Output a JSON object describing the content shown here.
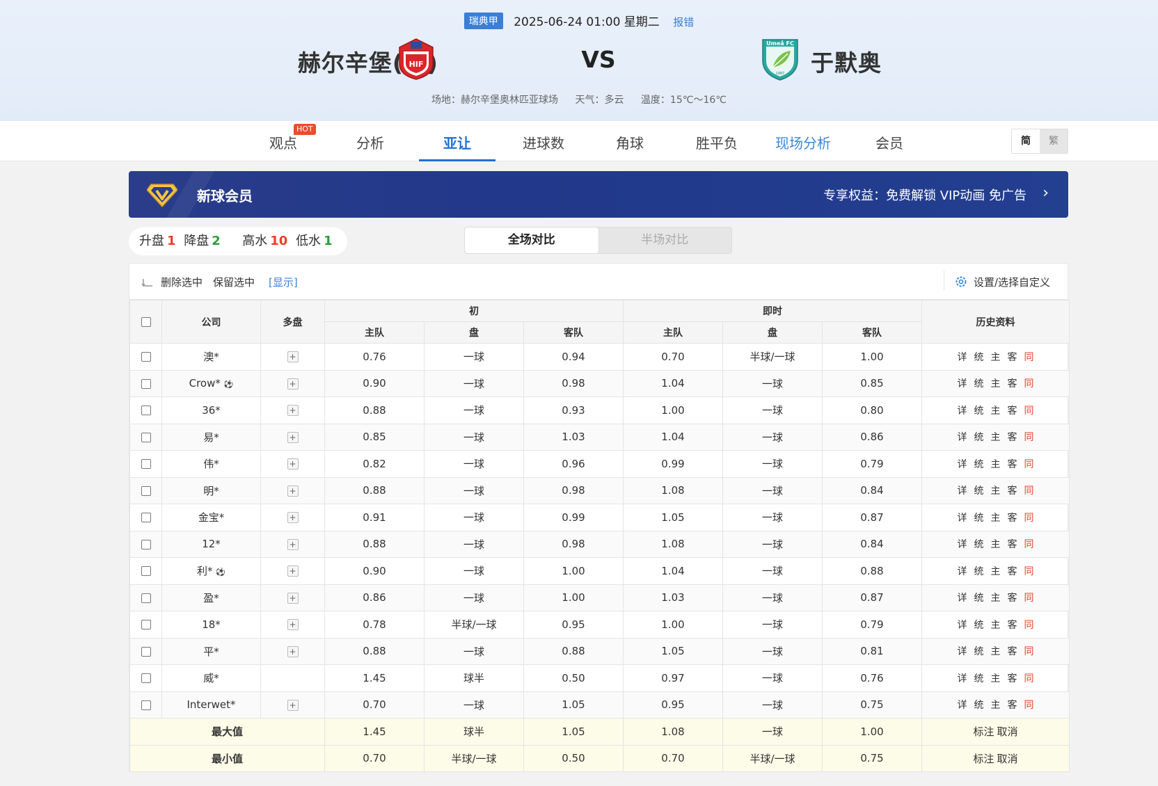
{
  "match": {
    "league": "瑞典甲",
    "datetime": "2025-06-24 01:00 星期二",
    "report": "报错",
    "home": "赫尔辛堡(主)",
    "vs": "VS",
    "away": "于默奥",
    "venue": "场地：赫尔辛堡奥林匹亚球场",
    "weather": "天气：多云",
    "temperature": "温度：15℃～16℃",
    "home_logo_text": "HIF",
    "away_logo_text": "Umeå FC",
    "away_logo_year": "1987"
  },
  "nav": {
    "items": [
      "观点",
      "分析",
      "亚让",
      "进球数",
      "角球",
      "胜平负",
      "现场分析",
      "会员"
    ],
    "active": "亚让",
    "hot": "HOT",
    "lang_simplified": "简",
    "lang_traditional": "繁"
  },
  "vip": {
    "title": "新球会员",
    "perks": "专享权益：免费解锁 VIP动画 免广告"
  },
  "summary": {
    "up_label": "升盘",
    "up": "1",
    "down_label": "降盘",
    "down": "2",
    "high_label": "高水",
    "high": "10",
    "low_label": "低水",
    "low": "1"
  },
  "compare": {
    "full": "全场对比",
    "half": "半场对比"
  },
  "toolbar": {
    "delete": "删除选中",
    "keep": "保留选中",
    "show": "[显示]",
    "settings": "设置/选择自定义"
  },
  "headers": {
    "company": "公司",
    "multi": "多盘",
    "initial": "初",
    "live": "即时",
    "home": "主队",
    "line": "盘",
    "away": "客队",
    "history": "历史资料"
  },
  "history_labels": [
    "详",
    "统",
    "主",
    "客",
    "同"
  ],
  "rows": [
    {
      "company": "澳*",
      "ball": false,
      "plus": true,
      "i_home": "0.76",
      "i_line": "一球",
      "i_away": "0.94",
      "l_home": "0.70",
      "l_line": "半球/一球",
      "l_away": "1.00"
    },
    {
      "company": "Crow*",
      "ball": true,
      "plus": true,
      "i_home": "0.90",
      "i_line": "一球",
      "i_away": "0.98",
      "l_home": "1.04",
      "l_line": "一球",
      "l_away": "0.85"
    },
    {
      "company": "36*",
      "ball": false,
      "plus": true,
      "i_home": "0.88",
      "i_line": "一球",
      "i_away": "0.93",
      "l_home": "1.00",
      "l_line": "一球",
      "l_away": "0.80"
    },
    {
      "company": "易*",
      "ball": false,
      "plus": true,
      "i_home": "0.85",
      "i_line": "一球",
      "i_away": "1.03",
      "l_home": "1.04",
      "l_line": "一球",
      "l_away": "0.86"
    },
    {
      "company": "伟*",
      "ball": false,
      "plus": true,
      "i_home": "0.82",
      "i_line": "一球",
      "i_away": "0.96",
      "l_home": "0.99",
      "l_line": "一球",
      "l_away": "0.79"
    },
    {
      "company": "明*",
      "ball": false,
      "plus": true,
      "i_home": "0.88",
      "i_line": "一球",
      "i_away": "0.98",
      "l_home": "1.08",
      "l_line": "一球",
      "l_away": "0.84"
    },
    {
      "company": "金宝*",
      "ball": false,
      "plus": true,
      "i_home": "0.91",
      "i_line": "一球",
      "i_away": "0.99",
      "l_home": "1.05",
      "l_line": "一球",
      "l_away": "0.87"
    },
    {
      "company": "12*",
      "ball": false,
      "plus": true,
      "i_home": "0.88",
      "i_line": "一球",
      "i_away": "0.98",
      "l_home": "1.08",
      "l_line": "一球",
      "l_away": "0.84"
    },
    {
      "company": "利*",
      "ball": true,
      "plus": true,
      "i_home": "0.90",
      "i_line": "一球",
      "i_away": "1.00",
      "l_home": "1.04",
      "l_line": "一球",
      "l_away": "0.88"
    },
    {
      "company": "盈*",
      "ball": false,
      "plus": true,
      "i_home": "0.86",
      "i_line": "一球",
      "i_away": "1.00",
      "l_home": "1.03",
      "l_line": "一球",
      "l_away": "0.87"
    },
    {
      "company": "18*",
      "ball": false,
      "plus": true,
      "i_home": "0.78",
      "i_line": "半球/一球",
      "i_away": "0.95",
      "l_home": "1.00",
      "l_line": "一球",
      "l_away": "0.79"
    },
    {
      "company": "平*",
      "ball": false,
      "plus": true,
      "i_home": "0.88",
      "i_line": "一球",
      "i_away": "0.88",
      "l_home": "1.05",
      "l_line": "一球",
      "l_away": "0.81"
    },
    {
      "company": "威*",
      "ball": false,
      "plus": false,
      "i_home": "1.45",
      "i_line": "球半",
      "i_away": "0.50",
      "l_home": "0.97",
      "l_line": "一球",
      "l_away": "0.76"
    },
    {
      "company": "Interwet*",
      "ball": false,
      "plus": true,
      "i_home": "0.70",
      "i_line": "一球",
      "i_away": "1.05",
      "l_home": "0.95",
      "l_line": "一球",
      "l_away": "0.75"
    }
  ],
  "stats": [
    {
      "label": "最大值",
      "i_home": "1.45",
      "i_line": "球半",
      "i_away": "1.05",
      "l_home": "1.08",
      "l_line": "一球",
      "l_away": "1.00",
      "mark": "标注",
      "cancel": "取消"
    },
    {
      "label": "最小值",
      "i_home": "0.70",
      "i_line": "半球/一球",
      "i_away": "0.50",
      "l_home": "0.70",
      "l_line": "半球/一球",
      "l_away": "0.75",
      "mark": "标注",
      "cancel": "取消"
    }
  ],
  "colors": {
    "accent": "#1f6fd6",
    "up": "#e8402a",
    "down": "#2f9b3c",
    "vip_bg": "#22388a",
    "stat_bg": "#fdfce8"
  }
}
